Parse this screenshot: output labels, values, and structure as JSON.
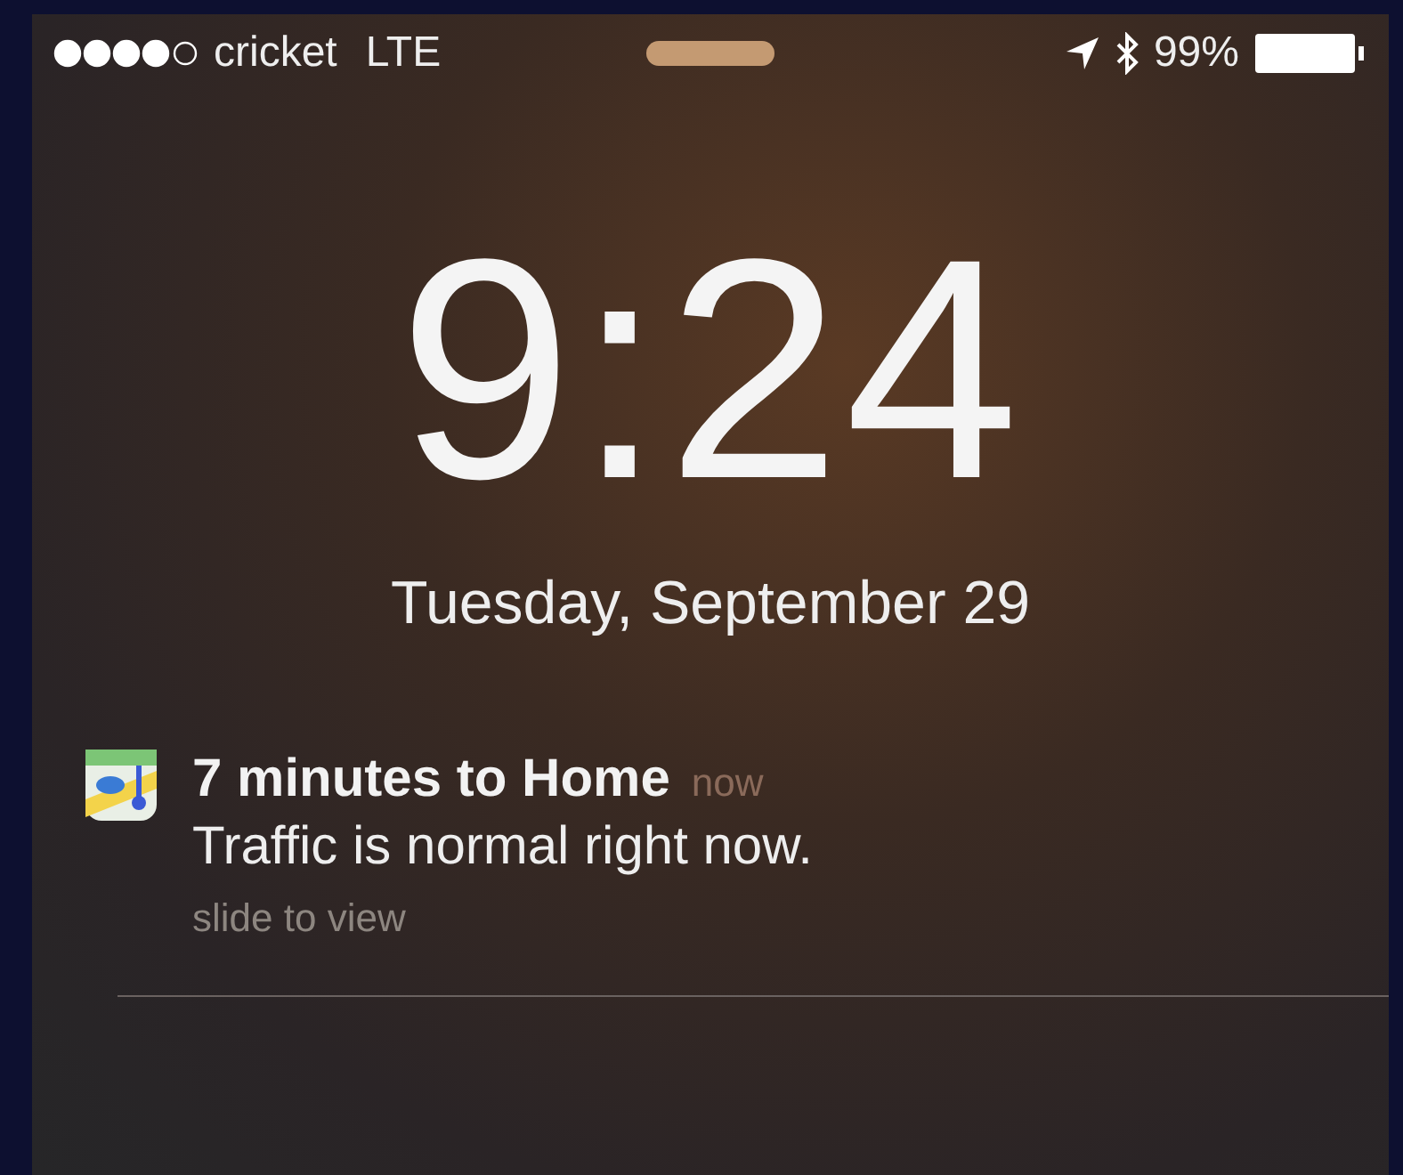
{
  "status_bar": {
    "carrier": "cricket",
    "network": "LTE",
    "battery": "99%"
  },
  "lock_screen": {
    "time": "9:24",
    "date": "Tuesday, September 29"
  },
  "notifications": [
    {
      "title": "7 minutes to Home",
      "time": "now",
      "message": "Traffic is normal right now.",
      "hint": "slide to view"
    }
  ]
}
